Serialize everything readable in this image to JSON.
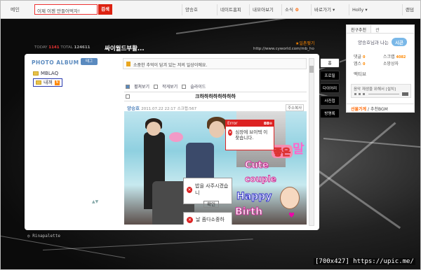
{
  "topbar": {
    "home": "메인",
    "search_value": "이제 이젠 만들어먹자!",
    "search_btn": "검색",
    "items": [
      {
        "label": "양승호"
      },
      {
        "label": "네이트홈피"
      },
      {
        "label": "내모아보기"
      },
      {
        "label": "소식",
        "badge": "0"
      },
      {
        "label": "바로가기"
      },
      {
        "label": "Holly"
      },
      {
        "label": "랜덤"
      }
    ]
  },
  "header": {
    "today_label": "TODAY",
    "today_value": "1141",
    "total_label": "TOTAL",
    "total_value": "124611",
    "title": "싸이월드부활...",
    "url": "http://www.cyworld.com/mb_ho",
    "share": "★일촌맺기"
  },
  "album": {
    "title": "PHOTO ALBUM",
    "btn": "태그",
    "folders": [
      {
        "label": "MBLAQ"
      },
      {
        "label": "내꺼"
      }
    ],
    "nav": "▲▼"
  },
  "main": {
    "notice": "소중한 추억이 담겨 있는 저의 일상이에요.",
    "views": [
      "펼쳐보기",
      "작게보기",
      "슬라이드"
    ],
    "post_title": "크하하하하하하하하",
    "author": "양승호",
    "date": "2011.07.22 22:17",
    "scrap": "스크랩:567",
    "copy": "주소복사"
  },
  "errors": {
    "big_title": "Error",
    "big_msg": "심장에 브이텍 이 찾습니다.",
    "mid_msg": "밥을 사주시겠습니",
    "mid_btn": "확인",
    "low_msg": "날 좀다소중하"
  },
  "stickers": [
    "좋은",
    "말",
    "Cute",
    "couple",
    "Happy",
    "Birth"
  ],
  "side": {
    "tab1": "친구추천",
    "tab2": "관",
    "friend_text": "양승호님과 나는",
    "friend_badge": "시곤",
    "stats": [
      {
        "label": "댓글",
        "value": "0"
      },
      {
        "label": "스크랩",
        "value": "4082"
      },
      {
        "label": "앱스",
        "value": "0"
      },
      {
        "label": "소망상자",
        "value": ""
      }
    ],
    "active": "액티브",
    "player": "음악 재생을 위해서 [설치]",
    "foot_a": "선물가게",
    "foot_b": "추천BGM"
  },
  "menus": [
    "홈",
    "프로필",
    "다이어리",
    "사진첩",
    "방명록"
  ],
  "footer": {
    "credit": "Rinapalette",
    "watermark": "[700x427] https://upic.me/"
  }
}
